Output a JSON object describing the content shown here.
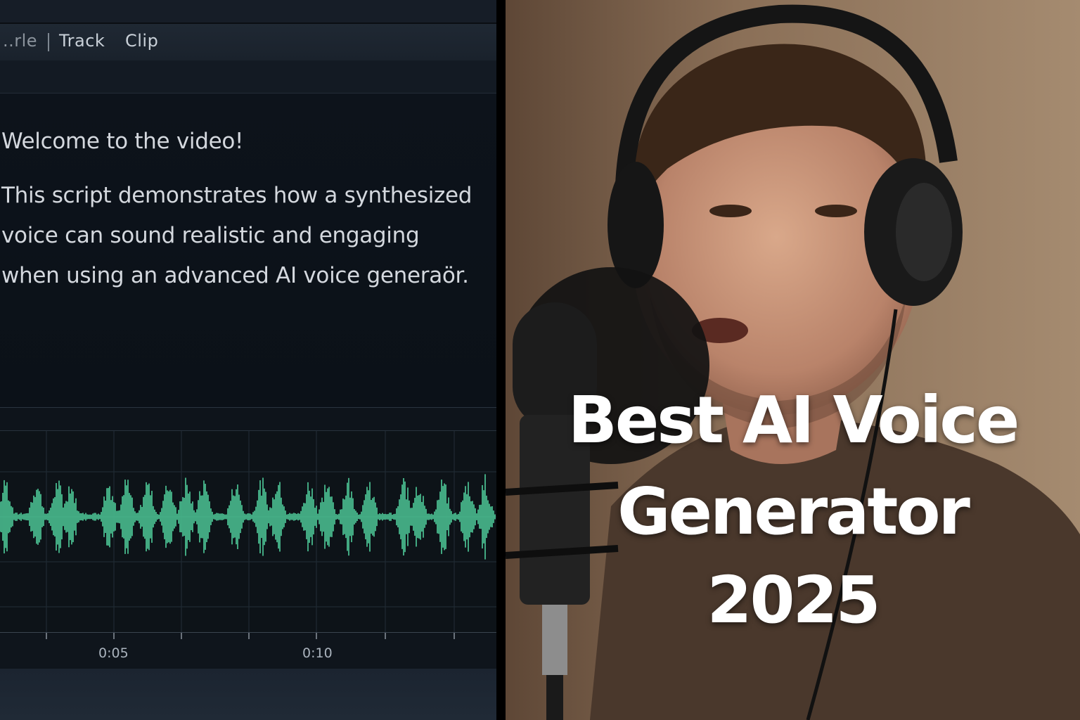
{
  "menu": {
    "items": [
      {
        "label": "..rle"
      },
      {
        "label": "Track"
      },
      {
        "label": "Clip"
      }
    ]
  },
  "script": {
    "greeting": "Welcome to the video!",
    "lines": [
      "This script demonstrates how a synthesized",
      "voice can sound realistic and engaging",
      "when using an advanced AI voice generaör."
    ]
  },
  "timeline": {
    "markers": [
      "0:05",
      "0:10"
    ]
  },
  "waveform": {
    "color": "#4fcf9c"
  },
  "thumbnail": {
    "title_lines": [
      "Best AI Voice",
      "Generator",
      "2025"
    ],
    "image_description_icon": "podcaster-with-microphone-and-headphones"
  }
}
